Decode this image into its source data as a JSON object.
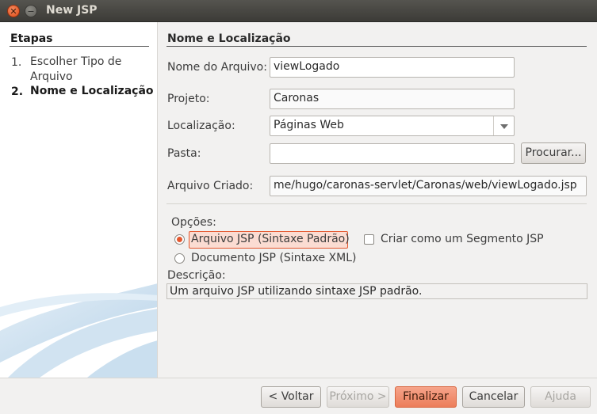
{
  "window": {
    "title": "New JSP"
  },
  "steps": {
    "title": "Etapas",
    "items": [
      {
        "num": "1.",
        "label_line1": "Escolher Tipo de",
        "label_line2": "Arquivo",
        "active": false
      },
      {
        "num": "2.",
        "label_line1": "Nome e Localização",
        "label_line2": "",
        "active": true
      }
    ]
  },
  "section": {
    "title": "Nome e Localização"
  },
  "form": {
    "nome_label": "Nome do Arquivo:",
    "nome_value": "viewLogado",
    "projeto_label": "Projeto:",
    "projeto_value": "Caronas",
    "localizacao_label": "Localização:",
    "localizacao_value": "Páginas Web",
    "pasta_label": "Pasta:",
    "pasta_value": "",
    "procurar_label": "Procurar...",
    "criado_label": "Arquivo Criado:",
    "criado_value": "me/hugo/caronas-servlet/Caronas/web/viewLogado.jsp"
  },
  "options": {
    "title": "Opções:",
    "radio1_label": "Arquivo JSP (Sintaxe Padrão)",
    "radio2_label": "Documento JSP (Sintaxe XML)",
    "checkbox_label": "Criar como um Segmento JSP",
    "selected": "radio1",
    "checkbox_checked": false
  },
  "description": {
    "title": "Descrição:",
    "text": "Um arquivo JSP utilizando sintaxe JSP padrão."
  },
  "buttons": {
    "voltar": "< Voltar",
    "proximo": "Próximo >",
    "finalizar": "Finalizar",
    "cancelar": "Cancelar",
    "ajuda": "Ajuda"
  },
  "colors": {
    "accent": "#e4572e",
    "panel": "#f2f1f0",
    "titlebar": "#3c3b37"
  }
}
